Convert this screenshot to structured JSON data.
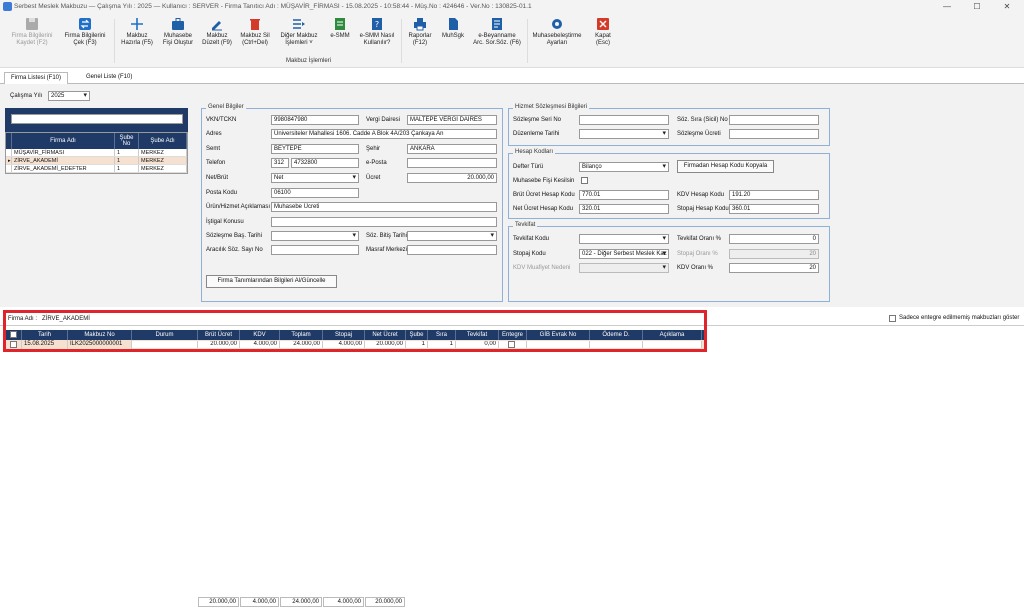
{
  "window": {
    "title": "Serbest Meslek Makbuzu  —  Çalışma Yılı : 2025  —  Kullanıcı : SERVER  -  Firma Tanıtıcı Adı : MÜŞAVİR_FİRMASI  -  15.08.2025 - 10:58:44  -  Müş.No : 424646  -  Ver.No : 130825-01.1"
  },
  "toolbar": {
    "firma_kaydet": "Firma Bilgilerini\nKaydet (F2)",
    "firma_cek": "Firma Bilgilerini\nÇek (F3)",
    "makbuz_hazirla": "Makbuz\nHazırla (F5)",
    "muhasebe_fisi": "Muhasebe\nFişi Oluştur",
    "makbuz_duzelt": "Makbuz\nDüzelt (F9)",
    "makbuz_sil": "Makbuz Sil\n(Ctrl+Del)",
    "diger_islemler": "Diğer Makbuz\nİşlemleri ˅",
    "esmm": "e-SMM",
    "esmm_nasil": "e-SMM Nasıl\nKullanılır?",
    "raporlar": "Raporlar\n(F12)",
    "muhsgk": "MuhSgk",
    "ebeyanname": "e-Beyanname\nArc. Sor.Söz. (F6)",
    "muhasebe_ayar": "Muhasebeleştirme\nAyarları",
    "kapat": "Kapat\n(Esc)",
    "group_label": "Makbuz İşlemleri"
  },
  "tabs": {
    "firma_listesi": "Firma Listesi (F10)",
    "genel_liste": "Genel Liste (F10)"
  },
  "calisma_yili": {
    "label": "Çalışma Yılı",
    "value": "2025"
  },
  "firma_grid": {
    "headers": [
      "Firma Adı",
      "Şube No",
      "Şube Adı"
    ],
    "rows": [
      {
        "ad": "MÜŞAVİR_FİRMASI",
        "no": "1",
        "sube": "MERKEZ"
      },
      {
        "ad": "ZİRVE_AKADEMİ",
        "no": "1",
        "sube": "MERKEZ"
      },
      {
        "ad": "ZİRVE_AKADEMİ_EDEFTER",
        "no": "1",
        "sube": "MERKEZ"
      }
    ]
  },
  "genel": {
    "legend": "Genel Bilgiler",
    "vkn_label": "VKN/TCKN",
    "vkn": "9980847980",
    "vd_label": "Vergi Dairesi",
    "vd": "MALTEPE VERGİ DAİRES",
    "adres_label": "Adres",
    "adres": "Üniversiteler Mahallesi 1606. Cadde A Blok 4A/203 Çankaya An",
    "semt_label": "Semt",
    "semt": "BEYTEPE",
    "sehir_label": "Şehir",
    "sehir": "ANKARA",
    "tel_label": "Telefon",
    "tel1": "312",
    "tel2": "4732800",
    "eposta_label": "e-Posta",
    "eposta": "",
    "netbrut_label": "Net/Brüt",
    "netbrut": "Net",
    "ucret_label": "Ücret",
    "ucret": "20.000,00",
    "posta_label": "Posta Kodu",
    "posta": "06100",
    "urun_label": "Ürün/Hizmet Açıklaması",
    "urun": "Muhasebe Ücreti",
    "istigal_label": "İştigal Konusu",
    "istigal": "",
    "sbas_label": "Sözleşme Baş. Tarihi",
    "sbas": "",
    "sbit_label": "Söz. Bitiş Tarihi",
    "sbit": "",
    "araci_label": "Aracılık Söz. Sayı No",
    "araci": "",
    "masraf_label": "Masraf Merkezi",
    "masraf": "",
    "btn": "Firma Tanımlarından Bilgileri Al/Güncelle"
  },
  "hizmet": {
    "legend": "Hizmet Sözleşmesi Bilgileri",
    "seri_label": "Sözleşme Seri No",
    "seri": "",
    "sira_label": "Söz. Sıra (Sicil) No",
    "sira": "",
    "duz_label": "Düzenleme Tarihi",
    "duz": "",
    "ucret_label": "Sözleşme Ücreti",
    "ucret": ""
  },
  "hesap": {
    "legend": "Hesap Kodları",
    "defter_label": "Defter Türü",
    "defter": "Bilanço",
    "btn": "Firmadan Hesap Kodu Kopyala",
    "fis_label": "Muhasebe Fişi Kesilsin",
    "brut_label": "Brüt Ücret Hesap Kodu",
    "brut": "770.01",
    "kdv_label": "KDV Hesap Kodu",
    "kdv": "191.20",
    "net_label": "Net Ücret Hesap Kodu",
    "net": "320.01",
    "stopaj_label": "Stopaj Hesap Kodu",
    "stopaj": "360.01"
  },
  "tevkifat": {
    "legend": "Tevkifat",
    "kodu_label": "Tevkifat Kodu",
    "kodu": "",
    "orani_label": "Tevkifat Oranı %",
    "orani": "0",
    "stopaj_label": "Stopaj Kodu",
    "stopaj": "022 - Diğer Serbest Meslek Kaz",
    "stopaj_orani_label": "Stopaj Oranı %",
    "stopaj_orani": "20",
    "muaf_label": "KDV Muafiyet Nedeni",
    "muaf": "",
    "kdv_orani_label": "KDV Oranı %",
    "kdv_orani": "20"
  },
  "makbuz": {
    "firma_label": "Firma Adı :",
    "firma": "ZİRVE_AKADEMİ",
    "sadece": "Sadece entegre edilmemiş makbuzları göster",
    "headers": [
      "Tarih",
      "Makbuz No",
      "Durum",
      "Brüt Ücret",
      "KDV",
      "Toplam",
      "Stopaj",
      "Net Ücret",
      "Şube",
      "Sıra",
      "Tevkifat",
      "Entegre",
      "GİB Evrak No",
      "Ödeme D.",
      "Açıklama"
    ],
    "row": {
      "tarih": "15.08.2025",
      "no": "ILK2025000000001",
      "durum": "",
      "brut": "20.000,00",
      "kdv": "4.000,00",
      "toplam": "24.000,00",
      "stopaj": "4.000,00",
      "net": "20.000,00",
      "sube": "1",
      "sira": "1",
      "tevkifat": "0,00"
    },
    "totals": [
      "20.000,00",
      "4.000,00",
      "24.000,00",
      "4.000,00",
      "20.000,00"
    ]
  }
}
